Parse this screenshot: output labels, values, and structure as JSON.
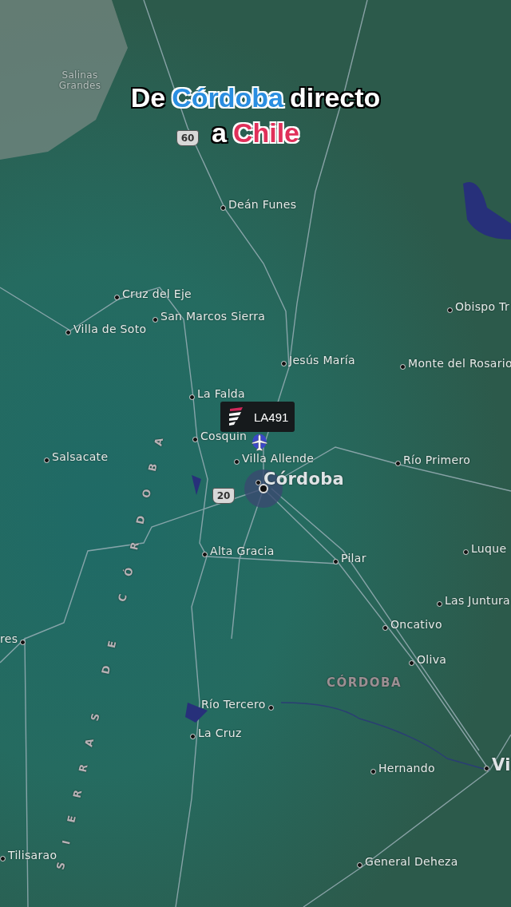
{
  "caption": [
    [
      {
        "text": "De",
        "kind": "plain",
        "color": "#ffffff"
      },
      {
        "text": "Córdoba",
        "kind": "highlight",
        "color": "#2a8ee0"
      },
      {
        "text": "directo",
        "kind": "plain",
        "color": "#ffffff"
      }
    ],
    [
      {
        "text": "a",
        "kind": "plain",
        "color": "#ffffff"
      },
      {
        "text": "Chile",
        "kind": "highlight",
        "color": "#e0305a"
      }
    ]
  ],
  "shields": [
    "60",
    "20"
  ],
  "flight": {
    "code": "LA491"
  },
  "places": [
    {
      "name": "Salinas Grandes",
      "kind": "area"
    },
    {
      "name": "Deán Funes",
      "kind": "town"
    },
    {
      "name": "Cruz del Eje",
      "kind": "town"
    },
    {
      "name": "San Marcos Sierra",
      "kind": "town"
    },
    {
      "name": "Villa de Soto",
      "kind": "town"
    },
    {
      "name": "Obispo Tr",
      "kind": "town"
    },
    {
      "name": "Jesús María",
      "kind": "town"
    },
    {
      "name": "Monte del Rosario",
      "kind": "town"
    },
    {
      "name": "La Falda",
      "kind": "town"
    },
    {
      "name": "Cosquín",
      "kind": "town"
    },
    {
      "name": "Salsacate",
      "kind": "town"
    },
    {
      "name": "Villa Allende",
      "kind": "town"
    },
    {
      "name": "Río Primero",
      "kind": "town"
    },
    {
      "name": "Córdoba",
      "kind": "city"
    },
    {
      "name": "Alta Gracia",
      "kind": "town"
    },
    {
      "name": "Pilar",
      "kind": "town"
    },
    {
      "name": "Luque",
      "kind": "town"
    },
    {
      "name": "Las Juntura",
      "kind": "town"
    },
    {
      "name": "Oncativo",
      "kind": "town"
    },
    {
      "name": "Oliva",
      "kind": "town"
    },
    {
      "name": "res",
      "kind": "town"
    },
    {
      "name": "CÓRDOBA",
      "kind": "region"
    },
    {
      "name": "Río Tercero",
      "kind": "town"
    },
    {
      "name": "La Cruz",
      "kind": "town"
    },
    {
      "name": "Hernando",
      "kind": "town"
    },
    {
      "name": "Vi",
      "kind": "city"
    },
    {
      "name": "Tilisarao",
      "kind": "town"
    },
    {
      "name": "General Deheza",
      "kind": "town"
    },
    {
      "name": "SIERRAS DE CÓRDOBA",
      "kind": "range"
    }
  ]
}
